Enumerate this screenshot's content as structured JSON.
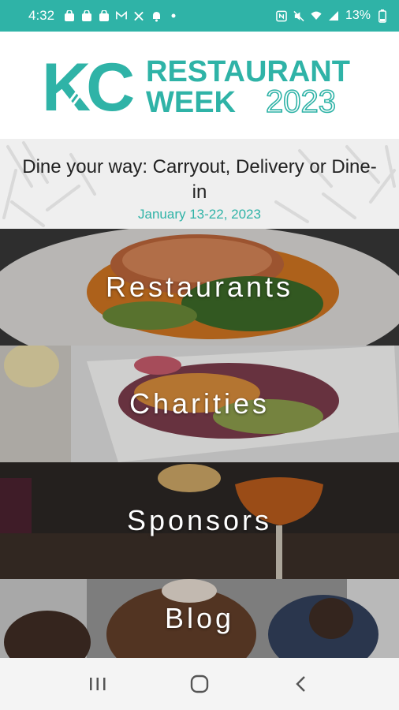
{
  "status_bar": {
    "time": "4:32",
    "battery": "13%",
    "left_icons": [
      "shopping-bag-icon",
      "shopping-bag-icon",
      "shopping-bag-icon",
      "gmail-icon",
      "tools-icon",
      "bell-icon",
      "dot-icon"
    ],
    "right_icons": [
      "nfc-icon",
      "mute-icon",
      "wifi-icon",
      "signal-icon",
      "battery-icon"
    ],
    "color": "#2fb3a7"
  },
  "header": {
    "logo_kc": "KC",
    "logo_line1": "RESTAURANT",
    "logo_line2_word": "WEEK",
    "logo_year": "2023",
    "brand_color": "#2fb3a7"
  },
  "tagline": {
    "text": "Dine your way: Carryout, Delivery or Dine-in",
    "dates": "January 13-22, 2023"
  },
  "menu": {
    "restaurants": "Restaurants",
    "charities": "Charities",
    "sponsors": "Sponsors",
    "blog": "Blog"
  },
  "nav": {
    "icons": [
      "recent-apps-icon",
      "home-icon",
      "back-icon"
    ]
  }
}
